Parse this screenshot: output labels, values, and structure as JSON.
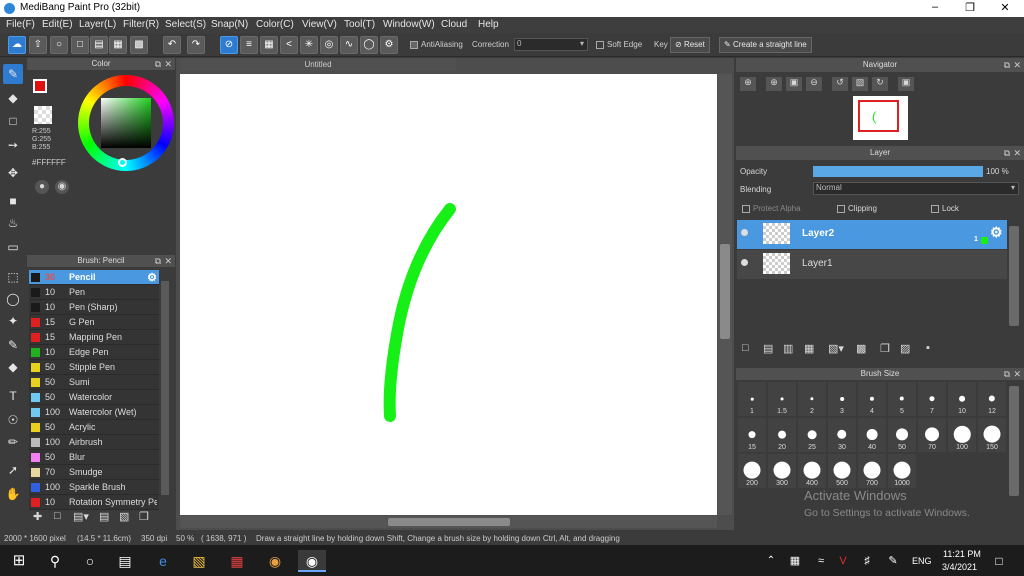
{
  "window": {
    "title": "MediBang Paint Pro (32bit)"
  },
  "menu": [
    "File(F)",
    "Edit(E)",
    "Layer(L)",
    "Filter(R)",
    "Select(S)",
    "Snap(N)",
    "Color(C)",
    "View(V)",
    "Tool(T)",
    "Window(W)",
    "Cloud",
    "Help"
  ],
  "toolbar": {
    "antialiasing": "AntiAliasing",
    "correction_label": "Correction",
    "correction_value": "0",
    "soft_edge": "Soft Edge",
    "key": "Key",
    "reset": "Reset",
    "straight_line": "Create a straight line"
  },
  "color_panel": {
    "title": "Color",
    "r": "R:255",
    "g": "G:255",
    "b": "B:255",
    "hex": "#FFFFFF",
    "fg_color": "#e01010",
    "bg_color": "#ffffff"
  },
  "brush_panel": {
    "title": "Brush: Pencil",
    "items": [
      {
        "size": "30",
        "name": "Pencil",
        "color": "#1a1a1a"
      },
      {
        "size": "10",
        "name": "Pen",
        "color": "#1a1a1a"
      },
      {
        "size": "10",
        "name": "Pen (Sharp)",
        "color": "#1a1a1a"
      },
      {
        "size": "15",
        "name": "G Pen",
        "color": "#e02020"
      },
      {
        "size": "15",
        "name": "Mapping Pen",
        "color": "#e02020"
      },
      {
        "size": "10",
        "name": "Edge Pen",
        "color": "#20b020"
      },
      {
        "size": "50",
        "name": "Stipple Pen",
        "color": "#e8d020"
      },
      {
        "size": "50",
        "name": "Sumi",
        "color": "#e8d020"
      },
      {
        "size": "50",
        "name": "Watercolor",
        "color": "#70c8f0"
      },
      {
        "size": "100",
        "name": "Watercolor (Wet)",
        "color": "#70c8f0"
      },
      {
        "size": "50",
        "name": "Acrylic",
        "color": "#e8d020"
      },
      {
        "size": "100",
        "name": "Airbrush",
        "color": "#bbbbbb"
      },
      {
        "size": "50",
        "name": "Blur",
        "color": "#f080f0"
      },
      {
        "size": "70",
        "name": "Smudge",
        "color": "#e8d8a0"
      },
      {
        "size": "100",
        "name": "Sparkle Brush",
        "color": "#3060e0"
      },
      {
        "size": "10",
        "name": "Rotation Symmetry Pe",
        "color": "#e02020"
      }
    ]
  },
  "canvas": {
    "tab": "Untitled",
    "stroke_color": "#16f016"
  },
  "navigator": {
    "title": "Navigator"
  },
  "layer_panel": {
    "title": "Layer",
    "opacity_label": "Opacity",
    "opacity_value": "100 %",
    "opacity": 1.0,
    "blending_label": "Blending",
    "blending_value": "Normal",
    "protect_alpha": "Protect Alpha",
    "clipping": "Clipping",
    "lock": "Lock",
    "layers": [
      {
        "name": "Layer2",
        "index": "1"
      },
      {
        "name": "Layer1",
        "index": ""
      }
    ]
  },
  "brush_size": {
    "title": "Brush Size",
    "sizes": [
      "1",
      "1.5",
      "2",
      "3",
      "4",
      "5",
      "7",
      "10",
      "12",
      "15",
      "20",
      "25",
      "30",
      "40",
      "50",
      "70",
      "100",
      "150",
      "200",
      "300",
      "400",
      "500",
      "700",
      "1000"
    ]
  },
  "status": {
    "doc_size": "2000 * 1600 pixel",
    "doc_cm": "(14.5 * 11.6cm)",
    "dpi": "350 dpi",
    "zoom": "50 %",
    "coords": "( 1638, 971 )",
    "hint": "Draw a straight line by holding down Shift, Change a brush size by holding down Ctrl, Alt, and dragging"
  },
  "watermark": {
    "line1": "Activate Windows",
    "line2": "Go to Settings to activate Windows."
  },
  "taskbar": {
    "lang": "ENG",
    "time": "11:21 PM",
    "date": "3/4/2021"
  }
}
